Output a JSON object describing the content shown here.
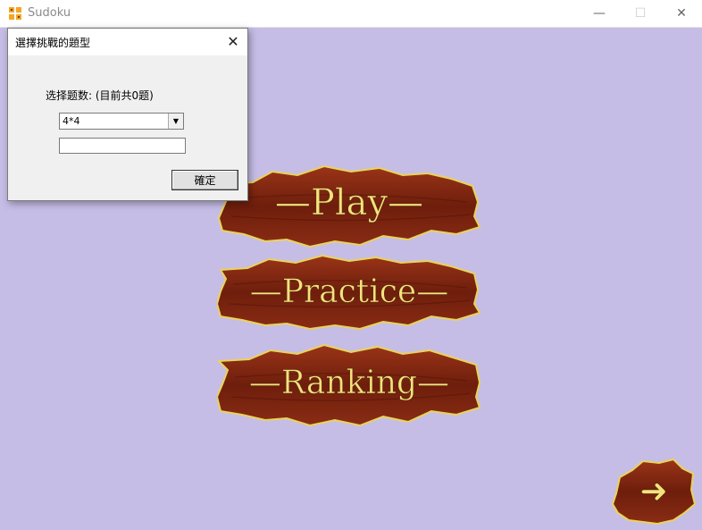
{
  "window": {
    "title": "Sudoku",
    "minimize_glyph": "—",
    "maximize_glyph": "☐",
    "close_glyph": "✕"
  },
  "menu": {
    "play_label": "—Play—",
    "practice_label": "—Practice—",
    "ranking_label": "—Ranking—",
    "next_glyph": "➜"
  },
  "dialog": {
    "title": "選擇挑戰的題型",
    "close_glyph": "✕",
    "count_label": "选择题数: (目前共0题)",
    "selected_type": "4*4",
    "input_value": "",
    "ok_label": "確定"
  },
  "colors": {
    "background": "#c6bde6",
    "wood": "#7a2410",
    "sign_text": "#f4e27c"
  },
  "icons": {
    "app": "sudoku-app-icon",
    "dropdown": "chevron-down-icon",
    "next": "arrow-right-icon"
  }
}
